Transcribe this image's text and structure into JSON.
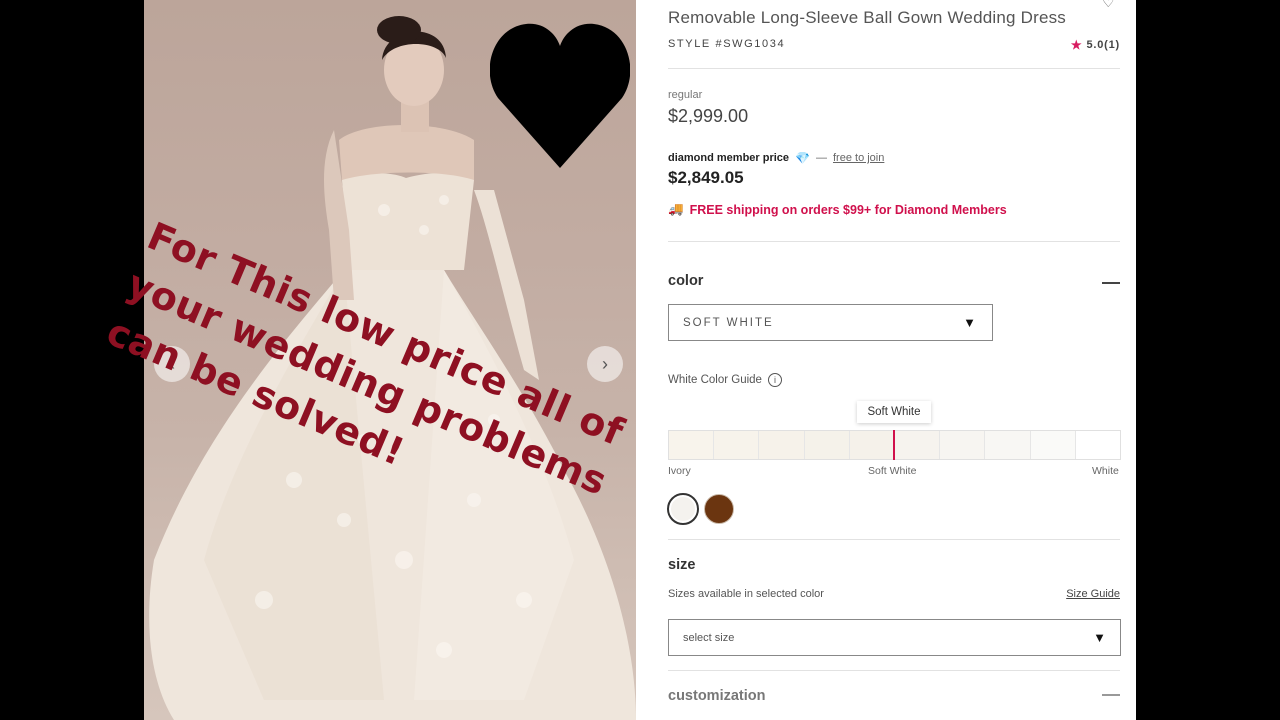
{
  "product": {
    "title": "Removable Long-Sleeve Ball Gown Wedding Dress",
    "style": "STYLE #SWG1034",
    "rating": "5.0(1)"
  },
  "pricing": {
    "regular_label": "regular",
    "regular_price": "$2,999.00",
    "member_label": "diamond member price",
    "member_dash": "—",
    "join_link": "free to join",
    "member_price": "$2,849.05",
    "shipping": "FREE shipping on orders $99+ for Diamond Members"
  },
  "color": {
    "section_title": "color",
    "selected": "SOFT WHITE",
    "guide_label": "White Color Guide",
    "tooltip": "Soft White",
    "scale_labels": [
      "Ivory",
      "Soft White",
      "White"
    ],
    "swatch_colors": [
      "#f8f4ec",
      "#f7f3eb",
      "#f6f2ea",
      "#f5f2ea",
      "#f5f1ea",
      "#f6f3ee",
      "#f7f5f1",
      "#f8f7f4",
      "#fafaf8",
      "#ffffff"
    ],
    "chips": [
      "#f4f2ee",
      "#6b3510"
    ]
  },
  "size": {
    "section_title": "size",
    "subtitle": "Sizes available in selected color",
    "guide_link": "Size Guide",
    "select_placeholder": "select size"
  },
  "customization": {
    "section_title": "customization"
  },
  "overlay": {
    "text": "For This low price all of\nyour wedding problems\ncan be solved!"
  },
  "colors": {
    "accent": "#d0104c",
    "overlay_text": "#8e1022"
  }
}
